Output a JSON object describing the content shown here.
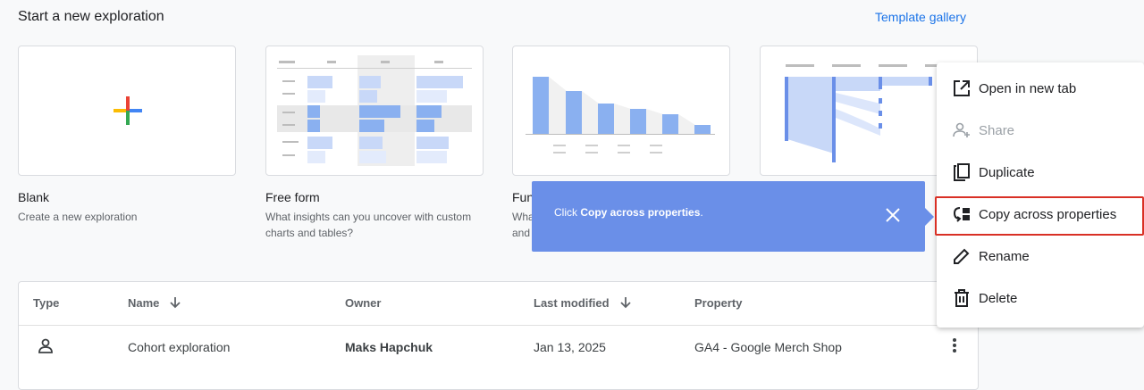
{
  "header": {
    "title": "Start a new exploration",
    "template_gallery": "Template gallery"
  },
  "cards": [
    {
      "title": "Blank",
      "description": "Create a new exploration"
    },
    {
      "title": "Free form",
      "description": "What insights can you uncover with custom charts and tables?"
    },
    {
      "title": "Fun",
      "description": "Wha and"
    },
    {
      "title": "",
      "description": ""
    }
  ],
  "table": {
    "columns": [
      "Type",
      "Name",
      "Owner",
      "Last modified",
      "Property"
    ],
    "rows": [
      {
        "name": "Cohort exploration",
        "owner": "Maks Hapchuk",
        "last_modified": "Jan 13, 2025",
        "property": "GA4 - Google Merch Shop"
      }
    ]
  },
  "tooltip": {
    "prefix": "Click ",
    "action": "Copy across properties",
    "suffix": "."
  },
  "menu": {
    "items": [
      {
        "label": "Open in new tab",
        "icon": "open-in-new-icon",
        "enabled": true
      },
      {
        "label": "Share",
        "icon": "person-add-icon",
        "enabled": false
      },
      {
        "label": "Duplicate",
        "icon": "copy-icon",
        "enabled": true
      },
      {
        "label": "Copy across properties",
        "icon": "copy-properties-icon",
        "enabled": true
      },
      {
        "label": "Rename",
        "icon": "pencil-icon",
        "enabled": true
      },
      {
        "label": "Delete",
        "icon": "trash-icon",
        "enabled": true
      }
    ]
  },
  "colors": {
    "accent": "#1a73e8",
    "tooltip": "#6a8fe8",
    "highlight": "#d93025",
    "chart_blue": "#8ab0f0"
  }
}
